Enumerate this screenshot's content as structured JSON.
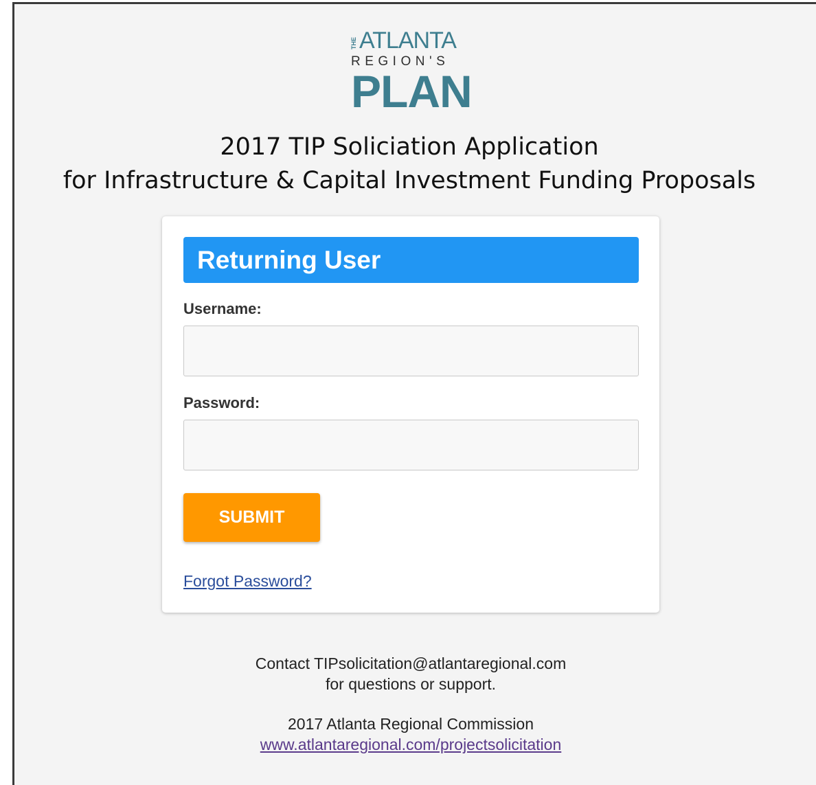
{
  "logo": {
    "the": "THE",
    "atlanta": "ATLANTA",
    "regions": "REGION'S",
    "plan": "PLAN"
  },
  "heading": {
    "line1": "2017 TIP Soliciation Application",
    "line2": "for Infrastructure & Capital Investment Funding Proposals"
  },
  "login": {
    "title": "Returning User",
    "username_label": "Username:",
    "username_value": "",
    "password_label": "Password:",
    "password_value": "",
    "submit_label": "SUBMIT",
    "forgot_label": "Forgot Password?"
  },
  "footer": {
    "contact_line1": "Contact TIPsolicitation@atlantaregional.com",
    "contact_line2": "for questions or support.",
    "org": "2017 Atlanta Regional Commission",
    "link": "www.atlantaregional.com/projectsolicitation"
  },
  "colors": {
    "header_blue": "#2196f3",
    "submit_orange": "#ff9800",
    "logo_teal": "#3e7e8f",
    "background": "#f4f4f4"
  }
}
